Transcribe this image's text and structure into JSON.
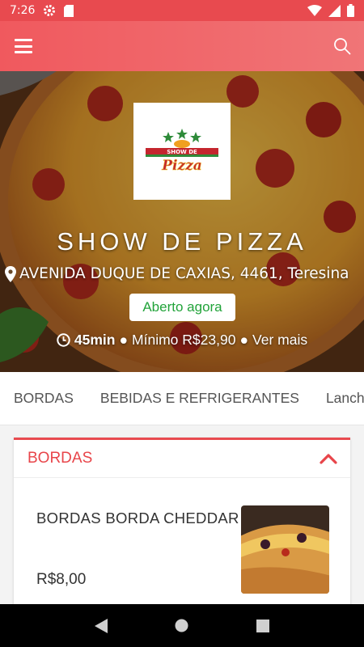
{
  "status_bar": {
    "time": "7:26"
  },
  "hero": {
    "restaurant_name": "SHOW DE PIZZA",
    "logo_text_top": "SHOW DE",
    "logo_text_bottom": "Pizza",
    "address": "AVENIDA DUQUE DE CAXIAS, 4461, Teresina",
    "open_status": "Aberto agora",
    "delivery_time": "45min",
    "bullet_1": "●",
    "minimum_order": "Mínimo R$23,90",
    "bullet_2": "●",
    "see_more": "Ver mais"
  },
  "tabs": [
    {
      "label": "BORDAS"
    },
    {
      "label": "BEBIDAS E REFRIGERANTES"
    },
    {
      "label": "Lanches"
    }
  ],
  "section": {
    "title": "BORDAS",
    "product": {
      "name": "BORDAS BORDA CHEDDAR",
      "price": "R$8,00"
    }
  },
  "colors": {
    "primary": "#e84a4f",
    "open_green": "#22a33a"
  },
  "icons": {
    "menu": "menu-icon",
    "search": "search-icon",
    "location": "map-pin-icon",
    "clock": "clock-icon",
    "collapse": "chevron-up-icon",
    "nav_back": "back-icon",
    "nav_home": "home-icon",
    "nav_recents": "recents-icon"
  }
}
